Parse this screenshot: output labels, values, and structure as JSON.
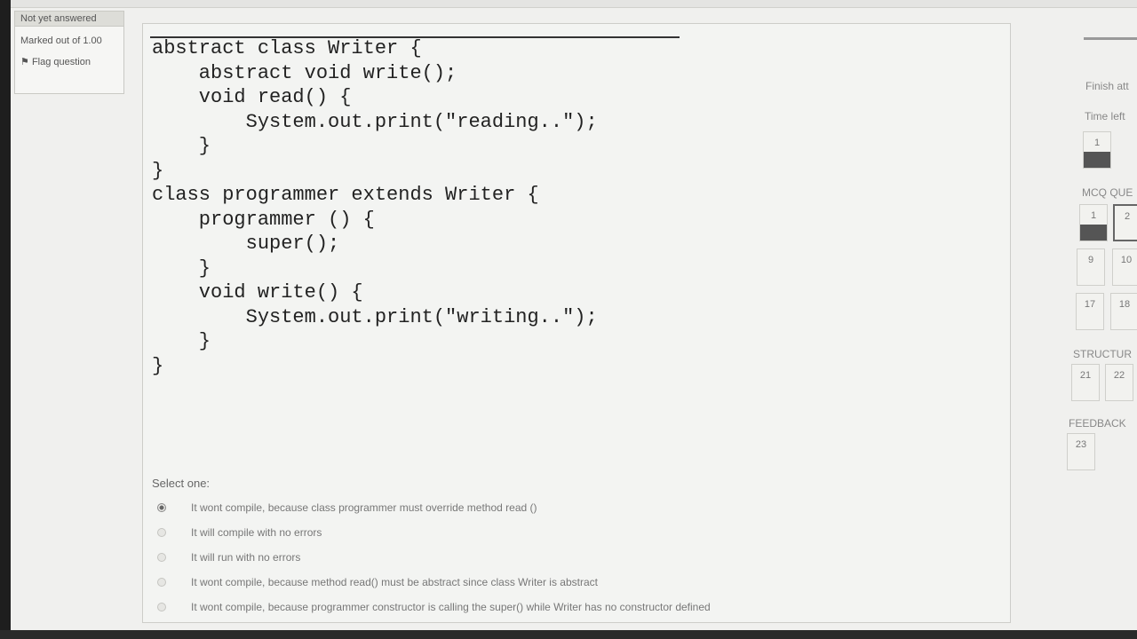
{
  "question_info": {
    "status": "Not yet answered",
    "marks": "Marked out of 1.00",
    "flag_label": "Flag question"
  },
  "code_lines": [
    "abstract class Writer {",
    "    abstract void write();",
    "    void read() {",
    "        System.out.print(\"reading..\");",
    "    }",
    "}",
    "class programmer extends Writer {",
    "    programmer () {",
    "        super();",
    "    }",
    "    void write() {",
    "        System.out.print(\"writing..\");",
    "    }",
    "}"
  ],
  "answer": {
    "prompt": "Select one:",
    "options": [
      "It wont compile, because class programmer must override method read ()",
      "It will compile with no errors",
      "It will run with no errors",
      "It wont compile, because method read() must be abstract since class Writer is abstract",
      "It wont compile, because  programmer constructor is calling the super() while Writer has no constructor defined"
    ],
    "selected_index": 0
  },
  "quiz_navigation": {
    "finish_label": "Finish att",
    "time_left_label": "Time left",
    "current_button": "1",
    "sections": [
      {
        "title": "MCQ QUE",
        "buttons": [
          "1",
          "2",
          "9",
          "10",
          "17",
          "18"
        ]
      },
      {
        "title": "STRUCTUR",
        "buttons": [
          "21",
          "22"
        ]
      },
      {
        "title": "FEEDBACK",
        "buttons": [
          "23"
        ]
      }
    ]
  }
}
